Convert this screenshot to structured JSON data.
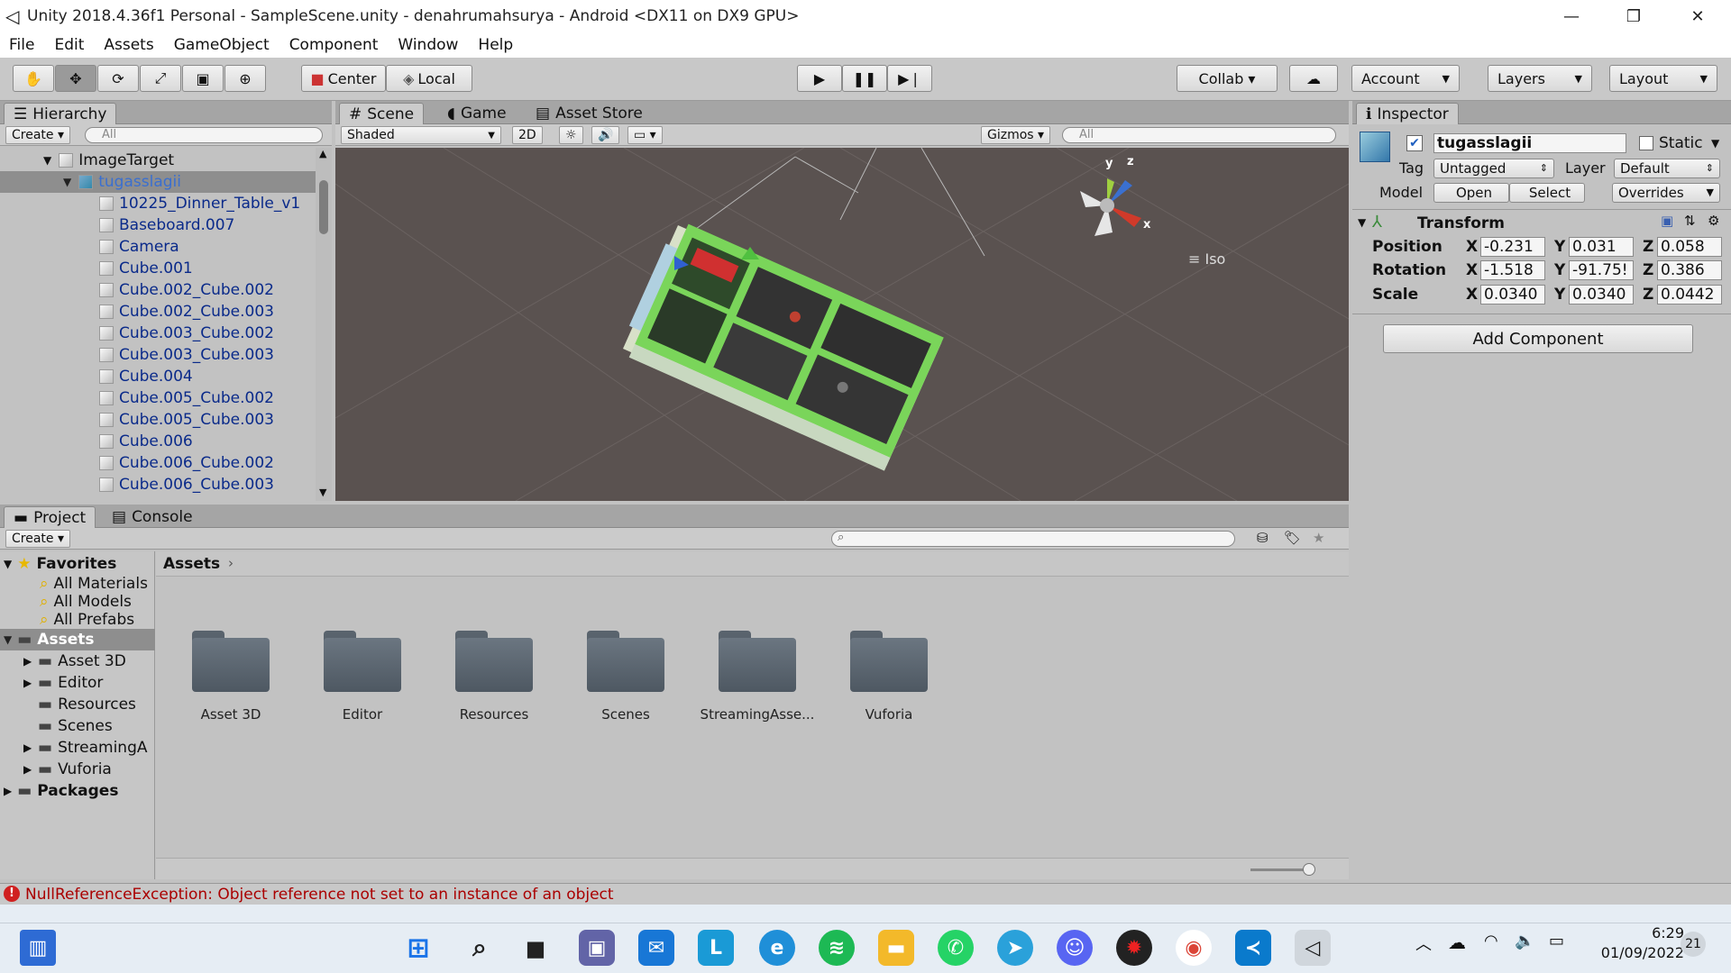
{
  "window": {
    "title": "Unity 2018.4.36f1 Personal - SampleScene.unity - denahrumahsurya - Android <DX11 on DX9 GPU>",
    "controls": [
      "—",
      "❐",
      "✕"
    ]
  },
  "menu": [
    "File",
    "Edit",
    "Assets",
    "GameObject",
    "Component",
    "Window",
    "Help"
  ],
  "toolbar": {
    "pivot": "Center",
    "space": "Local",
    "collab": "Collab ▾",
    "account": "Account",
    "layers": "Layers",
    "layout": "Layout"
  },
  "hierarchy": {
    "tab": "Hierarchy",
    "create": "Create",
    "search_placeholder": "All",
    "root": "ImageTarget",
    "selected": "tugasslagii",
    "children": [
      "10225_Dinner_Table_v1",
      "Baseboard.007",
      "Camera",
      "Cube.001",
      "Cube.002_Cube.002",
      "Cube.002_Cube.003",
      "Cube.003_Cube.002",
      "Cube.003_Cube.003",
      "Cube.004",
      "Cube.005_Cube.002",
      "Cube.005_Cube.003",
      "Cube.006",
      "Cube.006_Cube.002",
      "Cube.006_Cube.003"
    ]
  },
  "scene": {
    "tabs": [
      "Scene",
      "Game",
      "Asset Store"
    ],
    "shading": "Shaded",
    "mode2d": "2D",
    "gizmos": "Gizmos",
    "search_placeholder": "All",
    "iso_label": "Iso",
    "axis_x": "x",
    "axis_y": "y",
    "axis_z": "z"
  },
  "inspector": {
    "tab": "Inspector",
    "object_name": "tugasslagii",
    "static_label": "Static",
    "tag_label": "Tag",
    "tag_value": "Untagged",
    "layer_label": "Layer",
    "layer_value": "Default",
    "model_label": "Model",
    "open_btn": "Open",
    "select_btn": "Select",
    "overrides": "Overrides",
    "transform_title": "Transform",
    "position_label": "Position",
    "rotation_label": "Rotation",
    "scale_label": "Scale",
    "position": {
      "x": "-0.231",
      "y": "0.031",
      "z": "0.058"
    },
    "rotation": {
      "x": "-1.518",
      "y": "-91.75!",
      "z": "0.386"
    },
    "scale": {
      "x": "0.0340",
      "y": "0.0340",
      "z": "0.0442"
    },
    "add_component": "Add Component"
  },
  "project": {
    "tabs": [
      "Project",
      "Console"
    ],
    "create": "Create",
    "favorites_label": "Favorites",
    "favorites": [
      "All Materials",
      "All Models",
      "All Prefabs"
    ],
    "assets_label": "Assets",
    "asset_tree": [
      "Asset 3D",
      "Editor",
      "Resources",
      "Scenes",
      "StreamingA",
      "Vuforia"
    ],
    "packages_label": "Packages",
    "breadcrumb": "Assets",
    "folders": [
      "Asset 3D",
      "Editor",
      "Resources",
      "Scenes",
      "StreamingAsse...",
      "Vuforia"
    ]
  },
  "status": {
    "error": "NullReferenceException: Object reference not set to an instance of an object"
  },
  "taskbar": {
    "time": "6:29",
    "date": "01/09/2022",
    "notifications": "21"
  }
}
